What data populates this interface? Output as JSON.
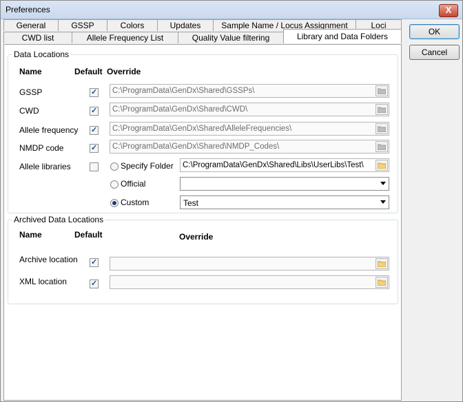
{
  "window": {
    "title": "Preferences",
    "close_label": "X"
  },
  "tabs_back": [
    "General",
    "GSSP",
    "Colors",
    "Updates",
    "Sample Name / Locus Assignment",
    "Loci"
  ],
  "tabs_front": [
    "CWD list",
    "Allele Frequency List",
    "Quality Value filtering",
    "Library and Data Folders"
  ],
  "active_tab": "Library and Data Folders",
  "data_locations": {
    "title": "Data Locations",
    "col_name": "Name",
    "col_default": "Default",
    "col_override": "Override",
    "rows": [
      {
        "name": "GSSP",
        "default": true,
        "path": "C:\\ProgramData\\GenDx\\Shared\\GSSPs\\"
      },
      {
        "name": "CWD",
        "default": true,
        "path": "C:\\ProgramData\\GenDx\\Shared\\CWD\\"
      },
      {
        "name": "Allele frequency",
        "default": true,
        "path": "C:\\ProgramData\\GenDx\\Shared\\AlleleFrequencies\\"
      },
      {
        "name": "NMDP code",
        "default": true,
        "path": "C:\\ProgramData\\GenDx\\Shared\\NMDP_Codes\\"
      }
    ],
    "allele_libraries": {
      "name": "Allele libraries",
      "default": false,
      "specify_label": "Specify Folder",
      "specify_path": "C:\\ProgramData\\GenDx\\Shared\\Libs\\UserLibs\\Test\\",
      "official_label": "Official",
      "official_value": "",
      "custom_label": "Custom",
      "custom_value": "Test",
      "selected": "Custom"
    }
  },
  "archived": {
    "title": "Archived Data Locations",
    "col_name": "Name",
    "col_default": "Default",
    "col_override": "Override",
    "rows": [
      {
        "name": "Archive location",
        "default": true,
        "path": ""
      },
      {
        "name": "XML location",
        "default": true,
        "path": ""
      }
    ]
  },
  "buttons": {
    "ok": "OK",
    "cancel": "Cancel"
  },
  "check_glyph": "✓"
}
